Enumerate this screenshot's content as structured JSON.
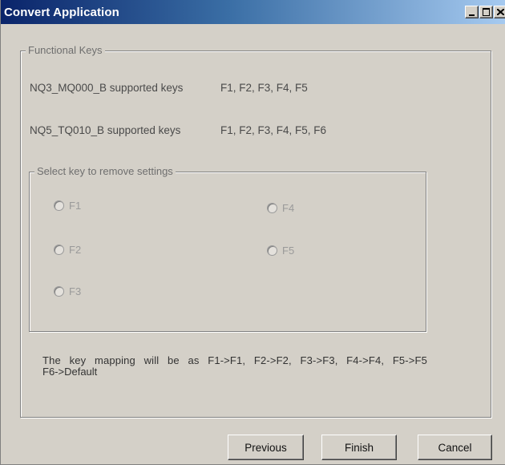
{
  "window": {
    "title": "Convert Application"
  },
  "functional_keys": {
    "group_title": "Functional Keys",
    "rows": [
      {
        "model": "NQ3_MQ000_B supported keys",
        "keys": "F1, F2, F3, F4, F5"
      },
      {
        "model": "NQ5_TQ010_B supported keys",
        "keys": "F1, F2, F3, F4, F5, F6"
      }
    ]
  },
  "remove_settings": {
    "group_title": "Select key to remove settings",
    "options": [
      {
        "label": "F1",
        "selected": false,
        "enabled": false
      },
      {
        "label": "F2",
        "selected": false,
        "enabled": false
      },
      {
        "label": "F3",
        "selected": false,
        "enabled": false
      },
      {
        "label": "F4",
        "selected": false,
        "enabled": false
      },
      {
        "label": "F5",
        "selected": false,
        "enabled": false
      }
    ]
  },
  "info": {
    "line1": "The key mapping will be as F1->F1, F2->F2, F3->F3, F4->F4, F5->F5",
    "line2": "F6->Default"
  },
  "buttons": {
    "previous": "Previous",
    "finish": "Finish",
    "cancel": "Cancel"
  }
}
